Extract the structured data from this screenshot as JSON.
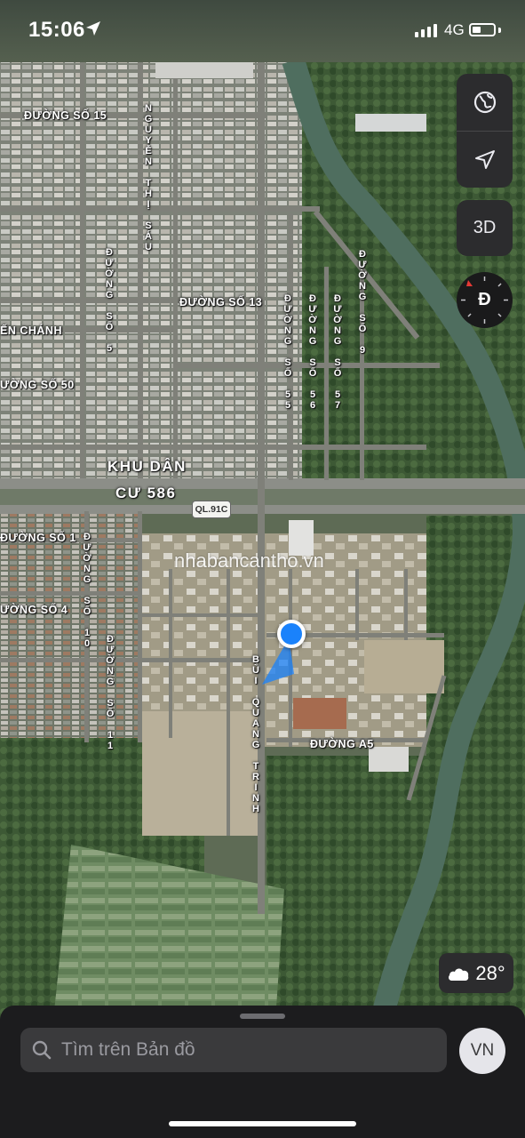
{
  "status_bar": {
    "time": "15:06",
    "network": "4G",
    "battery_level": 0.3,
    "signal_bars": 4
  },
  "map": {
    "labels": {
      "duong_so_15": "ĐƯỜNG SỐ 15",
      "nguyen_thi_sau": "NGUYỄN THỊ SÁU",
      "duong_so_5": "ĐƯỜNG SỐ 5",
      "duong_so_13": "ĐƯỜNG SỐ 13",
      "duong_so_9": "ĐƯỜNG SỐ 9",
      "duong_so_55": "ĐƯỜNG SỐ 55",
      "duong_so_56": "ĐƯỜNG SỐ 56",
      "duong_so_57": "ĐƯỜNG SỐ 57",
      "en_chanh": "ẾN CHÁNH",
      "duong_so_50": "ƯỜNG SỐ 50",
      "khu_dan_cu_line1": "KHU DÂN",
      "khu_dan_cu_line2": "CƯ 586",
      "duong_so_1": "ĐƯỜNG SỐ 1",
      "duong_so_10": "ĐƯỜNG SỐ 10",
      "duong_so_4": "ƯỜNG SỐ 4",
      "duong_so_11": "ĐƯỜNG SỐ 11",
      "bui_quang_trinh": "BÙI QUANG TRINH",
      "duong_a5": "ĐƯỜNG A5"
    },
    "highway_shield": "QL.91C",
    "watermark": "nhabancantho.vn"
  },
  "controls": {
    "map_mode_icon": "globe-icon",
    "locate_icon": "location-arrow-icon",
    "three_d_label": "3D",
    "compass_label": "Đ"
  },
  "weather": {
    "icon": "cloud-icon",
    "temperature": "28°"
  },
  "search": {
    "placeholder": "Tìm trên Bản đồ",
    "value": ""
  },
  "profile": {
    "initials": "VN"
  },
  "colors": {
    "accent": "#1a82fb",
    "sheet_bg": "#1c1c1e",
    "control_bg": "#2c2c2e",
    "compass_red": "#e53935"
  }
}
